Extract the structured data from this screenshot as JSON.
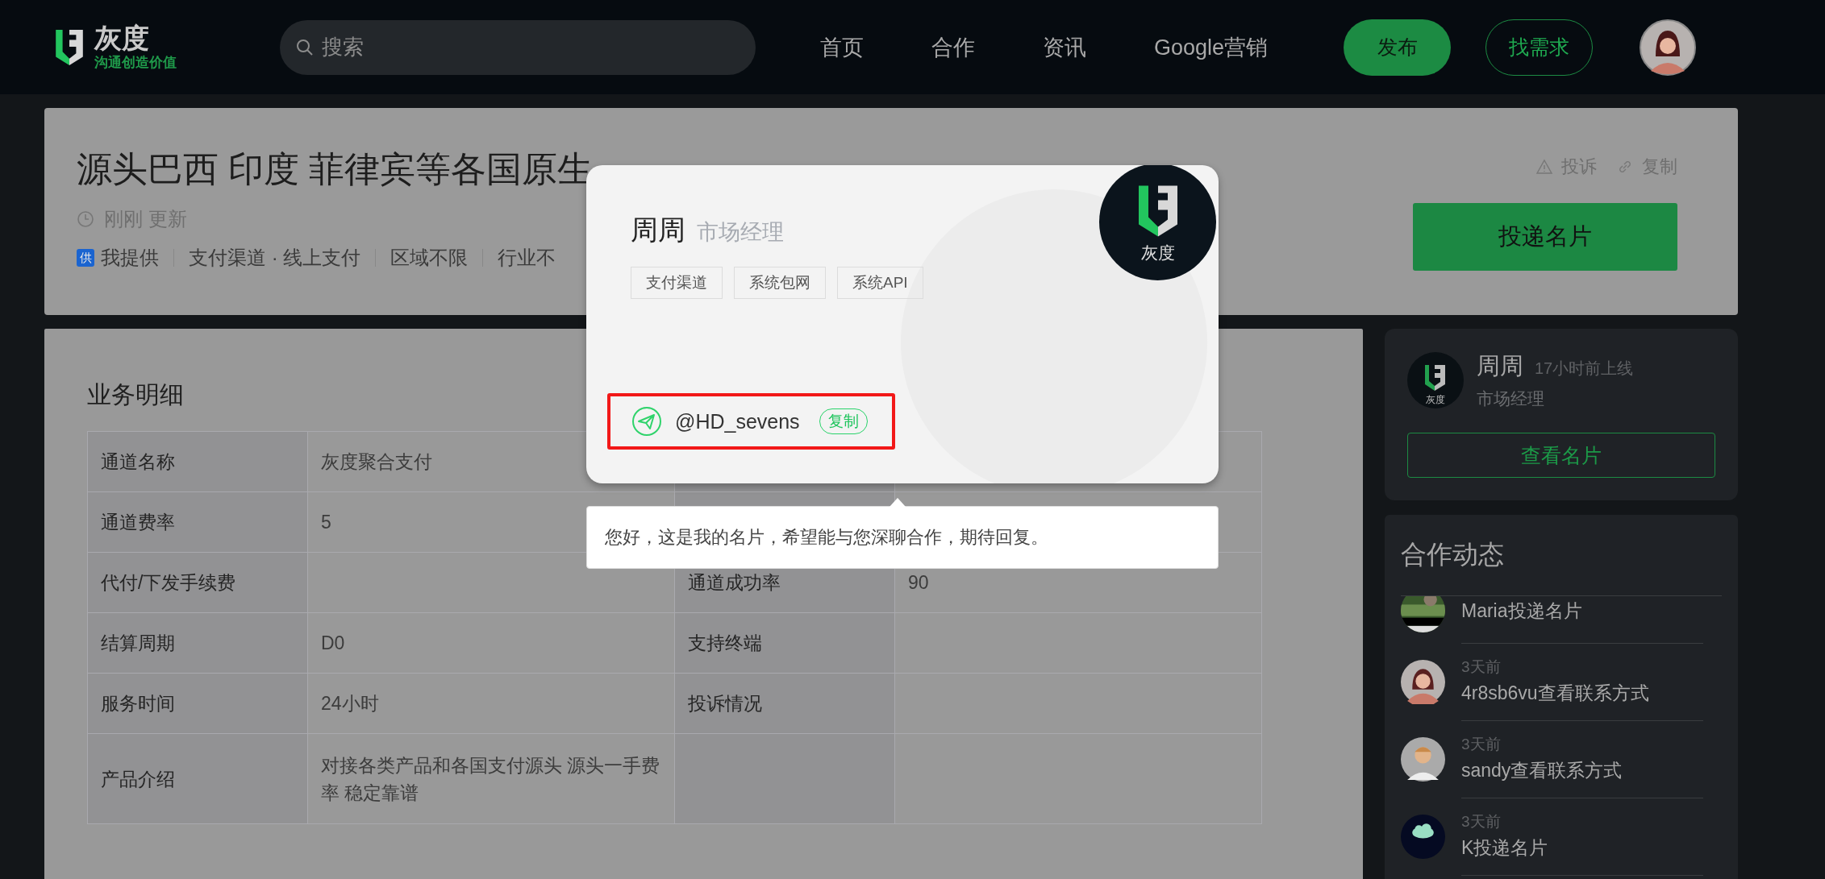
{
  "header": {
    "logo": {
      "name": "灰度",
      "slogan": "沟通创造价值"
    },
    "search": {
      "placeholder": "搜索"
    },
    "nav": [
      {
        "label": "首页"
      },
      {
        "label": "合作"
      },
      {
        "label": "资讯"
      },
      {
        "label": "Google营销"
      }
    ],
    "actions": [
      {
        "label": "发布",
        "kind": "primary"
      },
      {
        "label": "找需求",
        "kind": "outline"
      }
    ]
  },
  "listing": {
    "title": "源头巴西 印度 菲律宾等各国原生",
    "updated": "刚刚 更新",
    "provider_badge": "供",
    "provider": "我提供",
    "tags": [
      "支付渠道 · 线上支付",
      "区域不限",
      "行业不"
    ],
    "links": [
      {
        "label": "投诉",
        "kind": "report"
      },
      {
        "label": "复制",
        "kind": "link"
      }
    ],
    "cta": "投递名片"
  },
  "details": {
    "heading": "业务明细",
    "rows": [
      {
        "label": "通道名称",
        "value": "灰度聚合支付"
      },
      {
        "label": "通道费率",
        "value": "5"
      },
      {
        "label": "代付/下发手续费",
        "label_2": "通道成功率",
        "value_2": "90"
      },
      {
        "label": "结算周期",
        "value": "D0",
        "label_2": "支持终端"
      },
      {
        "label": "服务时间",
        "value": "24小时",
        "label_2": "投诉情况"
      },
      {
        "label": "产品介绍",
        "value": "对接各类产品和各国支付源头 源头一手费率 稳定靠谱"
      }
    ]
  },
  "card_popup": {
    "name": "周周",
    "role": "市场经理",
    "tags": [
      "支付渠道",
      "系统包网",
      "系统API"
    ],
    "logo_text": "灰度",
    "contact": {
      "handle": "@HD_sevens",
      "copy": "复制"
    },
    "message": "您好，这是我的名片，希望能与您深聊合作，期待回复。"
  },
  "sidebar": {
    "profile": {
      "avatar_text": "灰度",
      "name": "周周",
      "last_online": "17小时前上线",
      "role": "市场经理",
      "button": "查看名片"
    },
    "activity": {
      "heading": "合作动态",
      "items": [
        {
          "kind": "picture",
          "text": "Maria投递名片"
        },
        {
          "kind": "woman",
          "time": "3天前",
          "text": "4r8sb6vu查看联系方式"
        },
        {
          "kind": "man",
          "time": "3天前",
          "text": "sandy查看联系方式"
        },
        {
          "kind": "cloud",
          "time": "3天前",
          "text": "K投递名片"
        }
      ]
    }
  }
}
